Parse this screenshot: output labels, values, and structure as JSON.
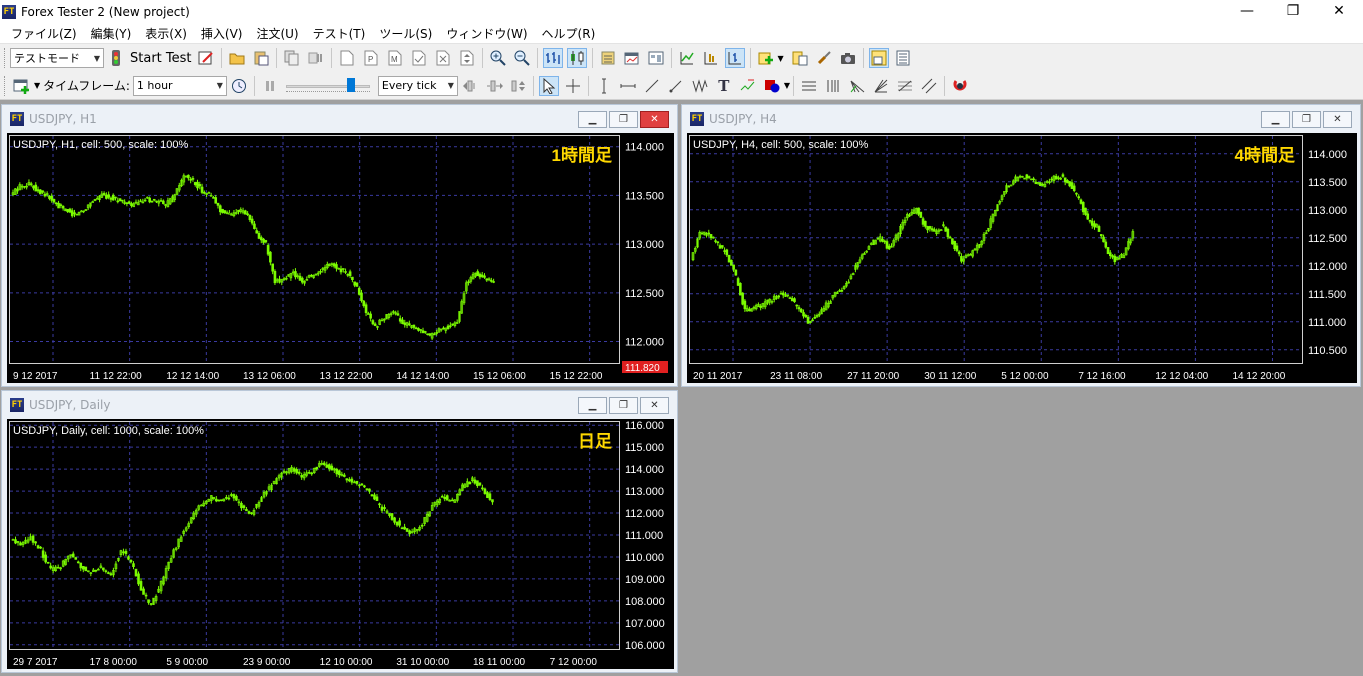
{
  "window": {
    "title": "Forex Tester 2  (New project)",
    "icon_text": "FT",
    "minimize_glyph": "—",
    "maximize_glyph": "❐",
    "close_glyph": "✕"
  },
  "menu": [
    "ファイル(Z)",
    "編集(Y)",
    "表示(X)",
    "挿入(V)",
    "注文(U)",
    "テスト(T)",
    "ツール(S)",
    "ウィンドウ(W)",
    "ヘルプ(R)"
  ],
  "toolbar1": {
    "mode_select": "テストモード",
    "start_test_label": "Start Test"
  },
  "toolbar2": {
    "timeframe_label": "タイムフレーム:",
    "timeframe_value": "1 hour",
    "tick_mode_value": "Every tick",
    "text_tool_glyph": "T",
    "speed_slider_level": 0.8
  },
  "colors": {
    "chart_bg": "#000000",
    "candle_green": "#7cfc00",
    "grid": "#3a3aa0",
    "annotation": "#ffd800",
    "axis_text": "#ffffff"
  },
  "charts": [
    {
      "id": "h1",
      "window_title": "USDJPY, H1",
      "active": true,
      "info": "USDJPY, H1, cell: 500, scale: 100%",
      "annotation": "1時間足",
      "ylim": [
        111.8,
        114.1
      ],
      "y_ticks": [
        "114.000",
        "113.500",
        "113.000",
        "112.500",
        "112.000"
      ],
      "x_ticks": [
        "9 12 2017",
        "11 12 22:00",
        "12 12 14:00",
        "13 12 06:00",
        "13 12 22:00",
        "14 12 14:00",
        "15 12 06:00",
        "15 12 22:00"
      ],
      "price_marker": "111.820",
      "series": [
        113.5,
        113.6,
        113.62,
        113.55,
        113.5,
        113.4,
        113.35,
        113.3,
        113.35,
        113.45,
        113.5,
        113.48,
        113.45,
        113.4,
        113.42,
        113.46,
        113.44,
        113.4,
        113.5,
        113.7,
        113.65,
        113.55,
        113.5,
        113.35,
        113.3,
        113.35,
        113.3,
        113.1,
        113.0,
        112.6,
        112.65,
        112.7,
        112.62,
        112.68,
        112.72,
        112.8,
        112.75,
        112.7,
        112.55,
        112.3,
        112.15,
        112.25,
        112.3,
        112.2,
        112.15,
        112.1,
        112.05,
        112.12,
        112.15,
        112.2,
        112.6,
        112.7,
        112.65,
        112.6
      ]
    },
    {
      "id": "h4",
      "window_title": "USDJPY, H4",
      "active": false,
      "info": "USDJPY, H4, cell: 500, scale: 100%",
      "annotation": "4時間足",
      "ylim": [
        110.3,
        114.3
      ],
      "y_ticks": [
        "114.000",
        "113.500",
        "113.000",
        "112.500",
        "112.000",
        "111.500",
        "111.000",
        "110.500"
      ],
      "x_ticks": [
        "20 11 2017",
        "23 11 08:00",
        "27 11 20:00",
        "30 11 12:00",
        "5 12 00:00",
        "7 12 16:00",
        "12 12 04:00",
        "14 12 20:00"
      ],
      "series": [
        112.1,
        112.6,
        112.55,
        112.4,
        112.2,
        111.8,
        111.2,
        111.25,
        111.3,
        111.4,
        111.5,
        111.45,
        111.2,
        111.0,
        111.1,
        111.3,
        111.5,
        111.6,
        111.9,
        112.2,
        112.4,
        112.5,
        112.3,
        112.6,
        112.9,
        113.0,
        112.7,
        112.6,
        112.7,
        112.4,
        112.1,
        112.2,
        112.4,
        112.7,
        113.1,
        113.4,
        113.55,
        113.6,
        113.5,
        113.45,
        113.55,
        113.6,
        113.45,
        113.2,
        112.8,
        112.7,
        112.3,
        112.1,
        112.2,
        112.6
      ]
    },
    {
      "id": "daily",
      "window_title": "USDJPY, Daily",
      "active": false,
      "info": "USDJPY, Daily, cell: 1000, scale: 100%",
      "annotation": "日足",
      "ylim": [
        105.9,
        116.1
      ],
      "y_ticks": [
        "116.000",
        "115.000",
        "114.000",
        "113.000",
        "112.000",
        "111.000",
        "110.000",
        "109.000",
        "108.000",
        "107.000",
        "106.000"
      ],
      "x_ticks": [
        "29 7 2017",
        "17 8 00:00",
        "5 9 00:00",
        "23 9 00:00",
        "12 10 00:00",
        "31 10 00:00",
        "18 11 00:00",
        "7 12 00:00"
      ],
      "series": [
        110.8,
        110.6,
        110.9,
        110.3,
        109.4,
        109.6,
        110.2,
        109.5,
        109.3,
        109.5,
        109.2,
        110.3,
        109.8,
        108.5,
        107.8,
        108.8,
        110.0,
        111.0,
        111.8,
        112.4,
        112.7,
        112.6,
        112.8,
        112.3,
        112.0,
        112.7,
        113.3,
        113.8,
        114.0,
        113.7,
        113.9,
        114.3,
        114.0,
        113.7,
        113.4,
        113.3,
        112.8,
        112.2,
        111.8,
        111.3,
        111.1,
        111.5,
        112.3,
        112.8,
        112.5,
        113.2,
        113.5,
        113.1,
        112.5
      ]
    }
  ]
}
